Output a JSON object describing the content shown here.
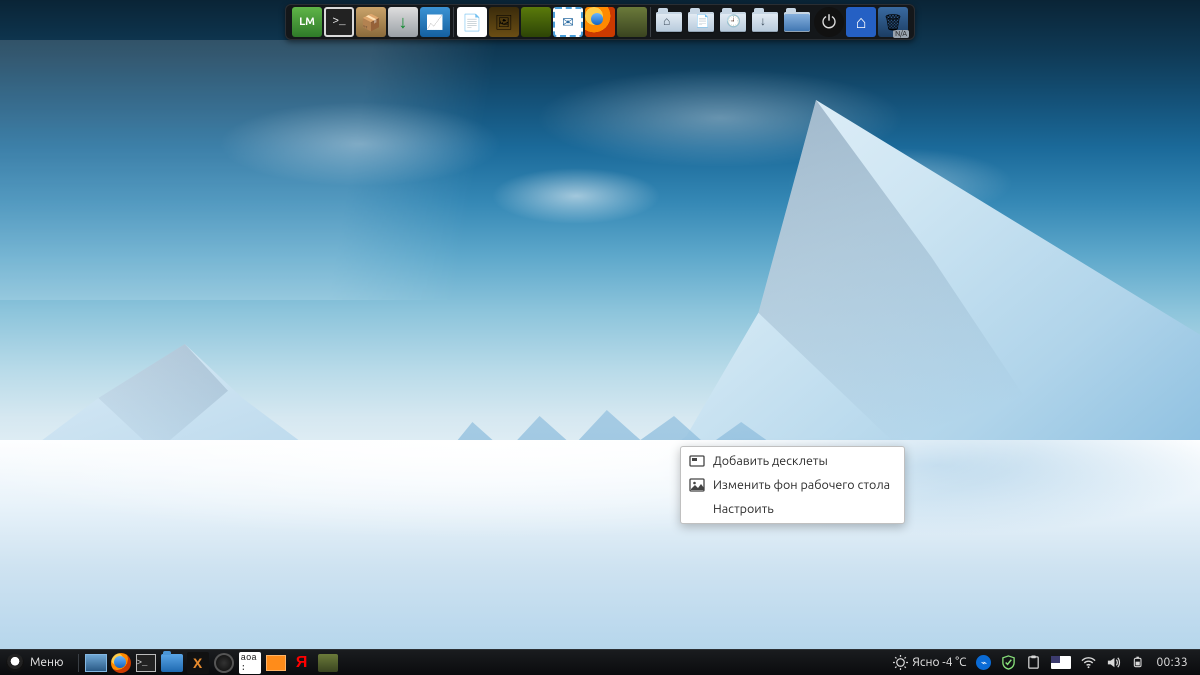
{
  "top_dock": {
    "groups": [
      [
        "mint-menu",
        "terminal",
        "software-manager",
        "update-manager",
        "system-monitor"
      ],
      [
        "libreoffice",
        "artwork-1",
        "artwork-2",
        "thunderbird",
        "firefox",
        "app-olive"
      ],
      [
        "folder-home",
        "folder-documents",
        "folder-recent",
        "folder-downloads",
        "folder-generic",
        "power",
        "accessibility",
        "trash"
      ]
    ],
    "na_badge": "N/A"
  },
  "context_menu": {
    "items": [
      {
        "icon": "add-desklet-icon",
        "label": "Добавить десклеты"
      },
      {
        "icon": "picture-icon",
        "label": "Изменить фон рабочего стола"
      },
      {
        "icon": "",
        "label": "Настроить"
      }
    ]
  },
  "panel": {
    "menu_label": "Меню",
    "launchers": [
      "show-desktop",
      "firefox",
      "terminal",
      "files",
      "plex",
      "obs",
      "keyboard-applet",
      "workspace-switcher",
      "yandex",
      "app-olive"
    ],
    "kbd_applet_text": "aoa :",
    "plex_glyph": "X",
    "yandex_glyph": "Я",
    "weather": {
      "icon": "weather-clear-icon",
      "text": "Ясно -4 °C"
    },
    "tray": [
      "bluetooth",
      "security",
      "clipboard",
      "keyboard-layout",
      "wifi",
      "volume",
      "battery"
    ],
    "clock": "00:33"
  }
}
